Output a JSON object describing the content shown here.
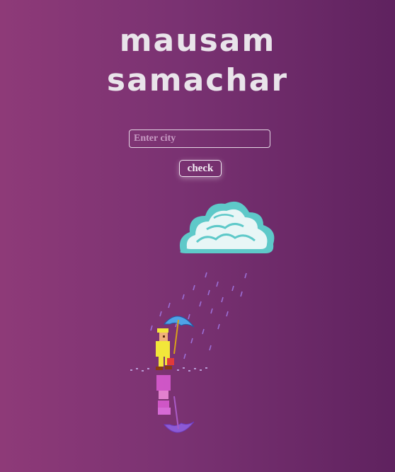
{
  "header": {
    "title_line1": "mausam",
    "title_line2": "samachar"
  },
  "search": {
    "placeholder": "Enter city",
    "value": ""
  },
  "actions": {
    "check_label": "check"
  },
  "colors": {
    "bg_left": "#8e3a78",
    "bg_right": "#5f225f",
    "cloud_outline": "#5ec9c9",
    "cloud_fill": "#e8f6f6",
    "rain": "#9b6fd6",
    "umbrella": "#4fa3e8",
    "raincoat": "#f2e63a"
  },
  "illustration": {
    "cloud": "pixel-cloud-icon",
    "character": "umbrella-walker-icon"
  }
}
